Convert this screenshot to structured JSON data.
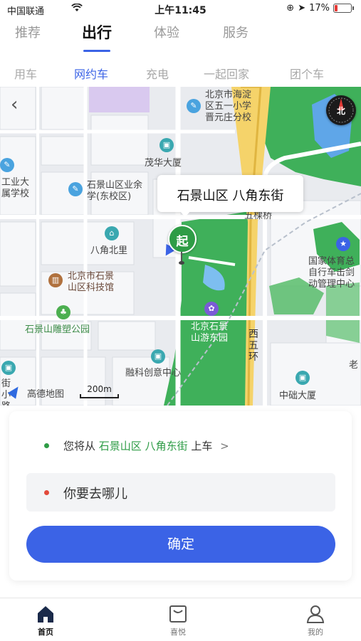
{
  "status_bar": {
    "carrier": "中国联通",
    "time": "上午11:45",
    "battery": "17%"
  },
  "top_tabs": [
    "推荐",
    "出行",
    "体验",
    "服务"
  ],
  "top_tab_active": "出行",
  "sub_tabs": [
    "用车",
    "网约车",
    "充电",
    "一起回家",
    "团个车"
  ],
  "sub_tab_active": "网约车",
  "map": {
    "callout": "石景山区 八角东街",
    "start_pin_label": "起",
    "compass_label": "北",
    "labels": {
      "school_top": "北京市海淀\n区五一小学\n晋元庄分校",
      "maohua": "茂华大厦",
      "industry": "工业大\n属学校",
      "yeyu": "石景山区业余\n学(东校区)",
      "wukeqiao": "五棵桥",
      "bajiao_north": "八角北里",
      "tech_museum": "北京市石景\n山区科技馆",
      "sculpture_park": "石景山雕塑公园",
      "youdong_park": "北京石景\n山游东园",
      "ring_road": "西\n五\n环",
      "cycling_center": "国家体育总\n自行车击剑\n动管理中心",
      "rongke": "融科创意中心",
      "zhongchu": "中础大厦",
      "left_bottom": "街\n小\n路",
      "right_edge": "老"
    },
    "scale": "200m",
    "brand": "高德地图"
  },
  "ride_panel": {
    "from_prefix": "您将从",
    "from_location": "石景山区 八角东街",
    "from_suffix": "上车",
    "from_arrow": ">",
    "destination_placeholder": "你要去哪儿",
    "confirm_label": "确定"
  },
  "tab_bar": {
    "items": [
      "首页",
      "喜悦",
      "我的"
    ],
    "active": "首页"
  },
  "colors": {
    "accent": "#3b63e6",
    "start_green": "#2e9c46",
    "dest_red": "#e24a3b"
  }
}
